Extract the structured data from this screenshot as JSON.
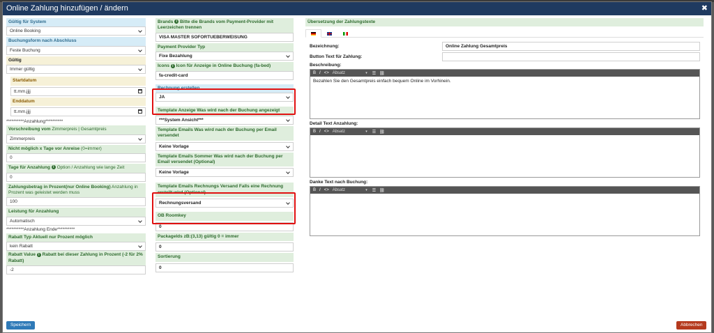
{
  "title": "Online Zahlung hinzufügen / ändern",
  "left": {
    "gueltig_system_label": "Gültig für System",
    "gueltig_system_value": "Online Booking",
    "buchungsform_label": "Buchungsform nach Abschluss",
    "buchungsform_value": "Feste Buchung",
    "gueltig_label": "Gültig",
    "gueltig_value": "Immer gültig",
    "startdatum_label": "Startdatum",
    "date_placeholder": "tt.mm.jjjj",
    "enddatum_label": "Enddatum",
    "anzahlung_start": "**********Anzahlung**********",
    "vorschreibung_label": "Vorschreibung vom",
    "vorschreibung_hint": " Zimmerpreis | Gesamtpreis",
    "vorschreibung_value": "Zimmerpreis",
    "nicht_moeglich_label": "Nicht möglich x Tage vor Anreise",
    "nicht_moeglich_hint": " (0=immer)",
    "nicht_moeglich_value": "0",
    "tage_label": "Tage für Anzahlung",
    "tage_hint": " Option / Anzahlung wie lange Zeit",
    "tage_value": "0",
    "zahlungsbetrag_label": "Zahlungsbetrag in Prozent(nur Online Booking)",
    "zahlungsbetrag_hint": " Anzahlung in Prozent was geleistet werden muss",
    "zahlungsbetrag_value": "100",
    "leistung_label": "Leistung für Anzahlung",
    "leistung_value": "Automatisch",
    "anzahlung_ende": "**********Anzahlung Ende**********",
    "rabatt_typ_label": "Rabatt Typ Aktuell nur Prozent möglich",
    "rabatt_typ_value": "kein Rabatt",
    "rabatt_value_label": "Rabatt Value",
    "rabatt_value_hint": "Rabatt bei dieser Zahlung in Prozent (-2 für 2% Rabatt)",
    "rabatt_value_value": "-2"
  },
  "mid": {
    "brands_label": "Brands",
    "brands_hint": "Bitte die Brands vom Payment-Provider mit Leerzeichen trennen",
    "brands_value": "VISA MASTER SOFORTUEBERWEISUNG",
    "provider_typ_label": "Payment Provider Typ",
    "provider_typ_value": "Fixe Bezahlung",
    "icons_label": "Icons",
    "icons_hint": "Icon für Anzeige in Online Buchung (fa-bed)",
    "icons_value": "fa-credit-card",
    "rechnung_label": "Rechnung erstellen",
    "rechnung_value": "JA",
    "template_anzeige_label": "Template Anzeige Was wird nach der Buchung angezeigt",
    "template_anzeige_value": "***System Ansicht***",
    "template_emails_label": "Template Emails Was wird nach der Buchung per Email versendet",
    "template_emails_value": "Keine Vorlage",
    "template_sommer_label": "Template Emails Sommer Was wird nach der Buchung per Email versendet (Optional)",
    "template_sommer_value": "Keine Vorlage",
    "template_rechnung_label": "Template Emails Rechnungs Versand Falls eine Rechnung erstellt wird (Optional)",
    "template_rechnung_value": "Rechnungsversand",
    "ob_roomkey_label": "OB Roomkey",
    "ob_roomkey_value": "0",
    "packageids_label": "PackageIds zB:(3,13) gültig 0 = immer",
    "packageids_value": "0",
    "sortierung_label": "Sortierung",
    "sortierung_value": "0"
  },
  "right": {
    "header": "Übersetzung der Zahlungstexte",
    "bezeichnung_label": "Bezeichnung:",
    "bezeichnung_value": "Online Zahlung Gesamtpreis",
    "button_text_label": "Button Text für Zahlung:",
    "button_text_value": "",
    "beschreibung_label": "Beschreibung:",
    "beschreibung_text": "Bezahlen Sie den Gesamtpreis einfach bequem Online im Vorhinein.",
    "detail_label": "Detail Text Anzahlung:",
    "danke_label": "Danke Text nach Buchung:",
    "format_dropdown": "Absatz"
  },
  "buttons": {
    "save": "Speichern",
    "cancel": "Abbrechen"
  },
  "colors": {
    "titlebar": "#1f3a60",
    "label_bg": "#dfeedd",
    "highlight": "#e01010",
    "save": "#2f7ab8",
    "cancel": "#b53a1e"
  }
}
